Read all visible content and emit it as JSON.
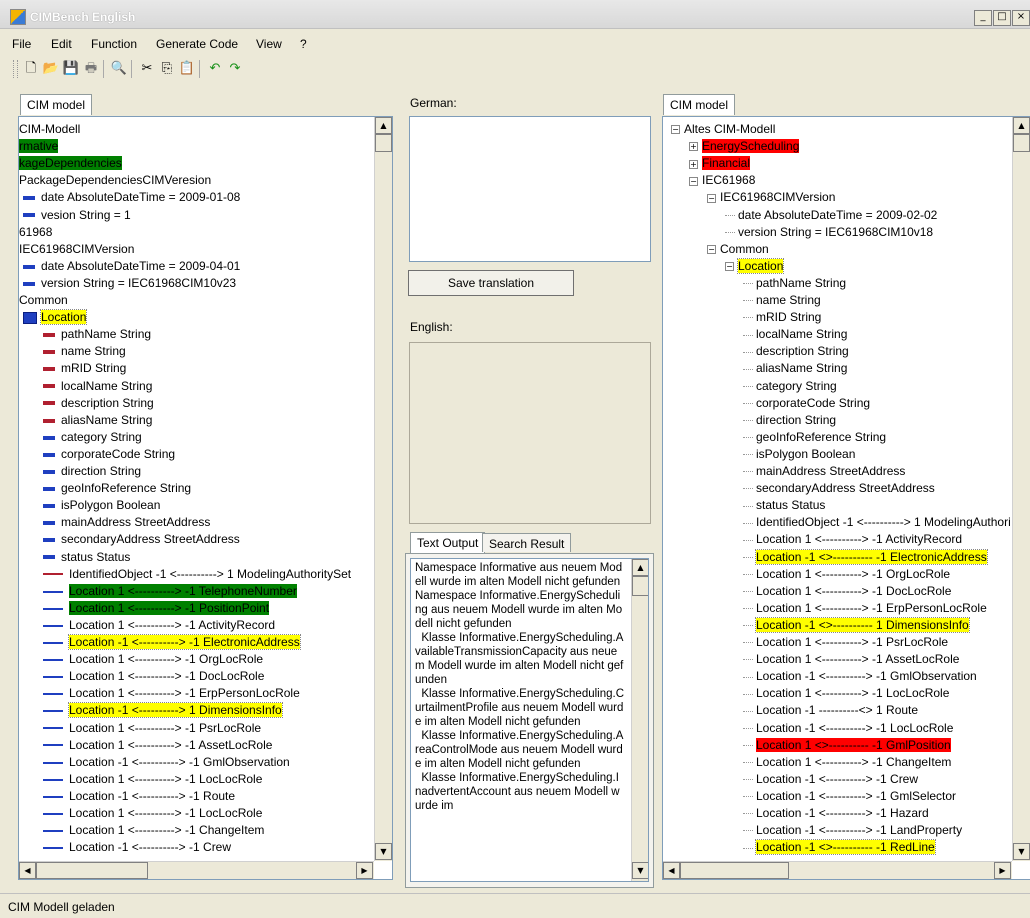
{
  "window": {
    "title": "CIMBench English",
    "buttons": [
      "_",
      "□",
      "×"
    ]
  },
  "menu": [
    "File",
    "Edit",
    "Function",
    "Generate Code",
    "View",
    "?"
  ],
  "toolbar": [
    "new-icon",
    "open-icon",
    "save-icon",
    "print-icon",
    "find-icon",
    "cut-icon",
    "copy-icon",
    "paste-icon",
    "undo-icon",
    "redo-icon"
  ],
  "left": {
    "tab": "CIM model",
    "rows": [
      {
        "t": "CIM-Modell",
        "s": ""
      },
      {
        "t": "rmative",
        "s": "green"
      },
      {
        "t": "kageDependencies",
        "s": "green"
      },
      {
        "t": "PackageDependenciesCIMVeresion",
        "s": ""
      },
      {
        "t": "date AbsoluteDateTime = 2009-01-08",
        "s": "",
        "i": "blue"
      },
      {
        "t": "vesion String = 1",
        "s": "",
        "i": "blue"
      },
      {
        "t": "61968",
        "s": ""
      },
      {
        "t": "IEC61968CIMVersion",
        "s": ""
      },
      {
        "t": "date AbsoluteDateTime = 2009-04-01",
        "s": "",
        "i": "blue"
      },
      {
        "t": "version String = IEC61968CIM10v23",
        "s": "",
        "i": "blue"
      },
      {
        "t": "Common",
        "s": ""
      },
      {
        "t": "Location",
        "s": "yellow",
        "i": "cls"
      },
      {
        "t": "pathName String",
        "s": "",
        "i": "red"
      },
      {
        "t": "name String",
        "s": "",
        "i": "red"
      },
      {
        "t": "mRID String",
        "s": "",
        "i": "red"
      },
      {
        "t": "localName String",
        "s": "",
        "i": "red"
      },
      {
        "t": "description String",
        "s": "",
        "i": "red"
      },
      {
        "t": "aliasName String",
        "s": "",
        "i": "red"
      },
      {
        "t": "category String",
        "s": "",
        "i": "blue"
      },
      {
        "t": "corporateCode String",
        "s": "",
        "i": "blue"
      },
      {
        "t": "direction String",
        "s": "",
        "i": "blue"
      },
      {
        "t": "geoInfoReference String",
        "s": "",
        "i": "blue"
      },
      {
        "t": "isPolygon Boolean",
        "s": "",
        "i": "blue"
      },
      {
        "t": "mainAddress StreetAddress",
        "s": "",
        "i": "blue"
      },
      {
        "t": "secondaryAddress StreetAddress",
        "s": "",
        "i": "blue"
      },
      {
        "t": "status Status",
        "s": "",
        "i": "blue"
      },
      {
        "t": "IdentifiedObject -1 <----------> 1 ModelingAuthoritySet",
        "s": "",
        "i": "linered"
      },
      {
        "t": "Location 1 <----------> -1 TelephoneNumber",
        "s": "green",
        "i": "line"
      },
      {
        "t": "Location 1 <----------> -1 PositionPoint",
        "s": "green",
        "i": "line"
      },
      {
        "t": "Location 1 <----------> -1 ActivityRecord",
        "s": "",
        "i": "line"
      },
      {
        "t": "Location -1 <----------> -1 ElectronicAddress",
        "s": "yellow",
        "i": "line"
      },
      {
        "t": "Location 1 <----------> -1 OrgLocRole",
        "s": "",
        "i": "line"
      },
      {
        "t": "Location 1 <----------> -1 DocLocRole",
        "s": "",
        "i": "line"
      },
      {
        "t": "Location 1 <----------> -1 ErpPersonLocRole",
        "s": "",
        "i": "line"
      },
      {
        "t": "Location -1 <----------> 1 DimensionsInfo",
        "s": "yellow",
        "i": "line"
      },
      {
        "t": "Location 1 <----------> -1 PsrLocRole",
        "s": "",
        "i": "line"
      },
      {
        "t": "Location 1 <----------> -1 AssetLocRole",
        "s": "",
        "i": "line"
      },
      {
        "t": "Location -1 <----------> -1 GmlObservation",
        "s": "",
        "i": "line"
      },
      {
        "t": "Location 1 <----------> -1 LocLocRole",
        "s": "",
        "i": "line"
      },
      {
        "t": "Location -1 <----------> -1 Route",
        "s": "",
        "i": "line"
      },
      {
        "t": "Location 1 <----------> -1 LocLocRole",
        "s": "",
        "i": "line"
      },
      {
        "t": "Location 1 <----------> -1 ChangeItem",
        "s": "",
        "i": "line"
      },
      {
        "t": "Location -1 <----------> -1 Crew",
        "s": "",
        "i": "line"
      }
    ]
  },
  "middle": {
    "german_label": "German:",
    "german_value": "",
    "save_button": "Save translation",
    "english_label": "English:",
    "english_value": "",
    "tabs": [
      "Text Output",
      "Search Result"
    ],
    "output": "Namespace Informative aus neuem Modell wurde im alten Modell nicht gefunden\nNamespace Informative.EnergyScheduling aus neuem Modell wurde im alten Modell nicht gefunden\n  Klasse Informative.EnergyScheduling.AvailableTransmissionCapacity aus neuem Modell wurde im alten Modell nicht gefunden\n  Klasse Informative.EnergyScheduling.CurtailmentProfile aus neuem Modell wurde im alten Modell nicht gefunden\n  Klasse Informative.EnergyScheduling.AreaControlMode aus neuem Modell wurde im alten Modell nicht gefunden\n  Klasse Informative.EnergyScheduling.InadvertentAccount aus neuem Modell wurde im"
  },
  "right": {
    "tab": "CIM model",
    "rows": [
      {
        "t": "Altes CIM-Modell",
        "s": "",
        "d": 0,
        "e": "−"
      },
      {
        "t": "EnergyScheduling",
        "s": "red",
        "d": 1,
        "e": "+"
      },
      {
        "t": "Financial",
        "s": "red",
        "d": 1,
        "e": "+"
      },
      {
        "t": "IEC61968",
        "s": "",
        "d": 1,
        "e": "−"
      },
      {
        "t": "IEC61968CIMVersion",
        "s": "",
        "d": 2,
        "e": "−"
      },
      {
        "t": "date AbsoluteDateTime = 2009-02-02",
        "s": "",
        "d": 3
      },
      {
        "t": "version String = IEC61968CIM10v18",
        "s": "",
        "d": 3
      },
      {
        "t": "Common",
        "s": "",
        "d": 2,
        "e": "−"
      },
      {
        "t": "Location",
        "s": "yellow",
        "d": 3,
        "e": "−"
      },
      {
        "t": "pathName String",
        "s": "",
        "d": 4
      },
      {
        "t": "name String",
        "s": "",
        "d": 4
      },
      {
        "t": "mRID String",
        "s": "",
        "d": 4
      },
      {
        "t": "localName String",
        "s": "",
        "d": 4
      },
      {
        "t": "description String",
        "s": "",
        "d": 4
      },
      {
        "t": "aliasName String",
        "s": "",
        "d": 4
      },
      {
        "t": "category String",
        "s": "",
        "d": 4
      },
      {
        "t": "corporateCode String",
        "s": "",
        "d": 4
      },
      {
        "t": "direction String",
        "s": "",
        "d": 4
      },
      {
        "t": "geoInfoReference String",
        "s": "",
        "d": 4
      },
      {
        "t": "isPolygon Boolean",
        "s": "",
        "d": 4
      },
      {
        "t": "mainAddress StreetAddress",
        "s": "",
        "d": 4
      },
      {
        "t": "secondaryAddress StreetAddress",
        "s": "",
        "d": 4
      },
      {
        "t": "status Status",
        "s": "",
        "d": 4
      },
      {
        "t": "IdentifiedObject -1 <----------> 1 ModelingAuthori",
        "s": "",
        "d": 4
      },
      {
        "t": "Location 1 <----------> -1 ActivityRecord",
        "s": "",
        "d": 4
      },
      {
        "t": "Location -1 <>---------- -1 ElectronicAddress",
        "s": "yellow",
        "d": 4
      },
      {
        "t": "Location 1 <----------> -1 OrgLocRole",
        "s": "",
        "d": 4
      },
      {
        "t": "Location 1 <----------> -1 DocLocRole",
        "s": "",
        "d": 4
      },
      {
        "t": "Location 1 <----------> -1 ErpPersonLocRole",
        "s": "",
        "d": 4
      },
      {
        "t": "Location -1 <>---------- 1 DimensionsInfo",
        "s": "yellow",
        "d": 4
      },
      {
        "t": "Location 1 <----------> -1 PsrLocRole",
        "s": "",
        "d": 4
      },
      {
        "t": "Location 1 <----------> -1 AssetLocRole",
        "s": "",
        "d": 4
      },
      {
        "t": "Location -1 <----------> -1 GmlObservation",
        "s": "",
        "d": 4
      },
      {
        "t": "Location 1 <----------> -1 LocLocRole",
        "s": "",
        "d": 4
      },
      {
        "t": "Location -1 ----------<> 1 Route",
        "s": "",
        "d": 4
      },
      {
        "t": "Location -1 <----------> -1 LocLocRole",
        "s": "",
        "d": 4
      },
      {
        "t": "Location 1 <>---------- -1 GmlPosition",
        "s": "red",
        "d": 4
      },
      {
        "t": "Location 1 <----------> -1 ChangeItem",
        "s": "",
        "d": 4
      },
      {
        "t": "Location -1 <----------> -1 Crew",
        "s": "",
        "d": 4
      },
      {
        "t": "Location -1 <----------> -1 GmlSelector",
        "s": "",
        "d": 4
      },
      {
        "t": "Location -1 <----------> -1 Hazard",
        "s": "",
        "d": 4
      },
      {
        "t": "Location -1 <----------> -1 LandProperty",
        "s": "",
        "d": 4
      },
      {
        "t": "Location -1 <>---------- -1 RedLine",
        "s": "yellow",
        "d": 4
      }
    ]
  },
  "status": "CIM Modell geladen",
  "colors": {
    "yellow": "#ffff00",
    "green": "#008000",
    "red": "#ff0000",
    "panel_bg": "#ece9d8"
  }
}
